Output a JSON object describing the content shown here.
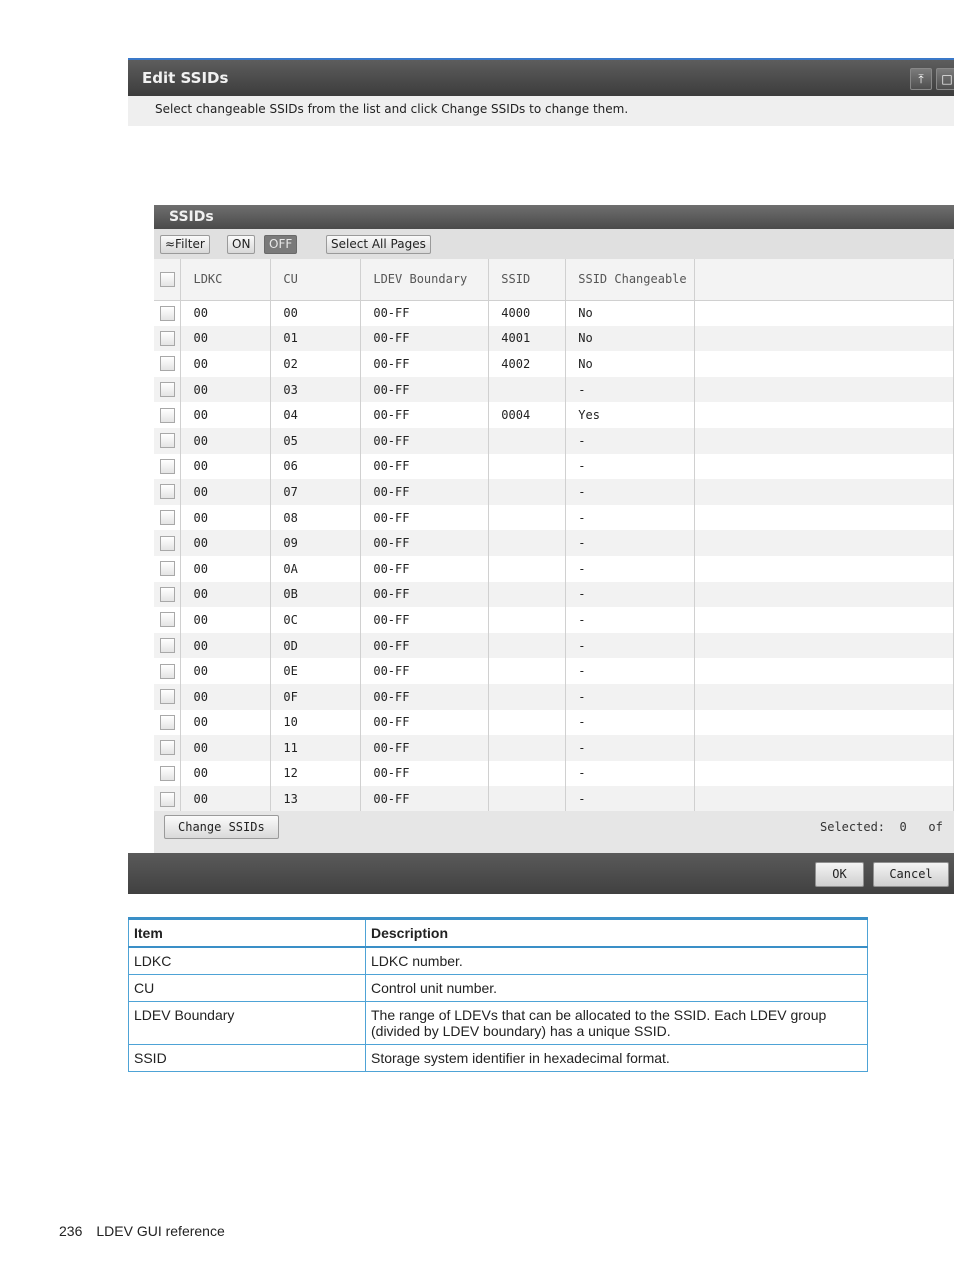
{
  "dialog": {
    "title": "Edit SSIDs",
    "instruction": "Select changeable SSIDs from the list and click Change SSIDs to change them.",
    "panel_title": "SSIDs",
    "toolbar": {
      "filter_label": "≈Filter",
      "on_label": "ON",
      "off_label": "OFF",
      "select_all_label": "Select All Pages"
    },
    "columns": [
      "LDKC",
      "CU",
      "LDEV Boundary",
      "SSID",
      "SSID Changeable"
    ],
    "rows": [
      [
        "00",
        "00",
        "00-FF",
        "4000",
        "No"
      ],
      [
        "00",
        "01",
        "00-FF",
        "4001",
        "No"
      ],
      [
        "00",
        "02",
        "00-FF",
        "4002",
        "No"
      ],
      [
        "00",
        "03",
        "00-FF",
        "",
        "-"
      ],
      [
        "00",
        "04",
        "00-FF",
        "0004",
        "Yes"
      ],
      [
        "00",
        "05",
        "00-FF",
        "",
        "-"
      ],
      [
        "00",
        "06",
        "00-FF",
        "",
        "-"
      ],
      [
        "00",
        "07",
        "00-FF",
        "",
        "-"
      ],
      [
        "00",
        "08",
        "00-FF",
        "",
        "-"
      ],
      [
        "00",
        "09",
        "00-FF",
        "",
        "-"
      ],
      [
        "00",
        "0A",
        "00-FF",
        "",
        "-"
      ],
      [
        "00",
        "0B",
        "00-FF",
        "",
        "-"
      ],
      [
        "00",
        "0C",
        "00-FF",
        "",
        "-"
      ],
      [
        "00",
        "0D",
        "00-FF",
        "",
        "-"
      ],
      [
        "00",
        "0E",
        "00-FF",
        "",
        "-"
      ],
      [
        "00",
        "0F",
        "00-FF",
        "",
        "-"
      ],
      [
        "00",
        "10",
        "00-FF",
        "",
        "-"
      ],
      [
        "00",
        "11",
        "00-FF",
        "",
        "-"
      ],
      [
        "00",
        "12",
        "00-FF",
        "",
        "-"
      ],
      [
        "00",
        "13",
        "00-FF",
        "",
        "-"
      ]
    ],
    "change_button": "Change SSIDs",
    "selected_text": "Selected:  0   of",
    "ok_label": "OK",
    "cancel_label": "Cancel"
  },
  "desc_table": {
    "headers": [
      "Item",
      "Description"
    ],
    "rows": [
      [
        "LDKC",
        "LDKC number."
      ],
      [
        "CU",
        "Control unit number."
      ],
      [
        "LDEV Boundary",
        "The range of LDEVs that can be allocated to the SSID. Each LDEV group (divided by LDEV boundary) has a unique SSID."
      ],
      [
        "SSID",
        "Storage system identifier in hexadecimal format."
      ]
    ]
  },
  "footer": {
    "page_number": "236",
    "section": "LDEV GUI reference"
  }
}
